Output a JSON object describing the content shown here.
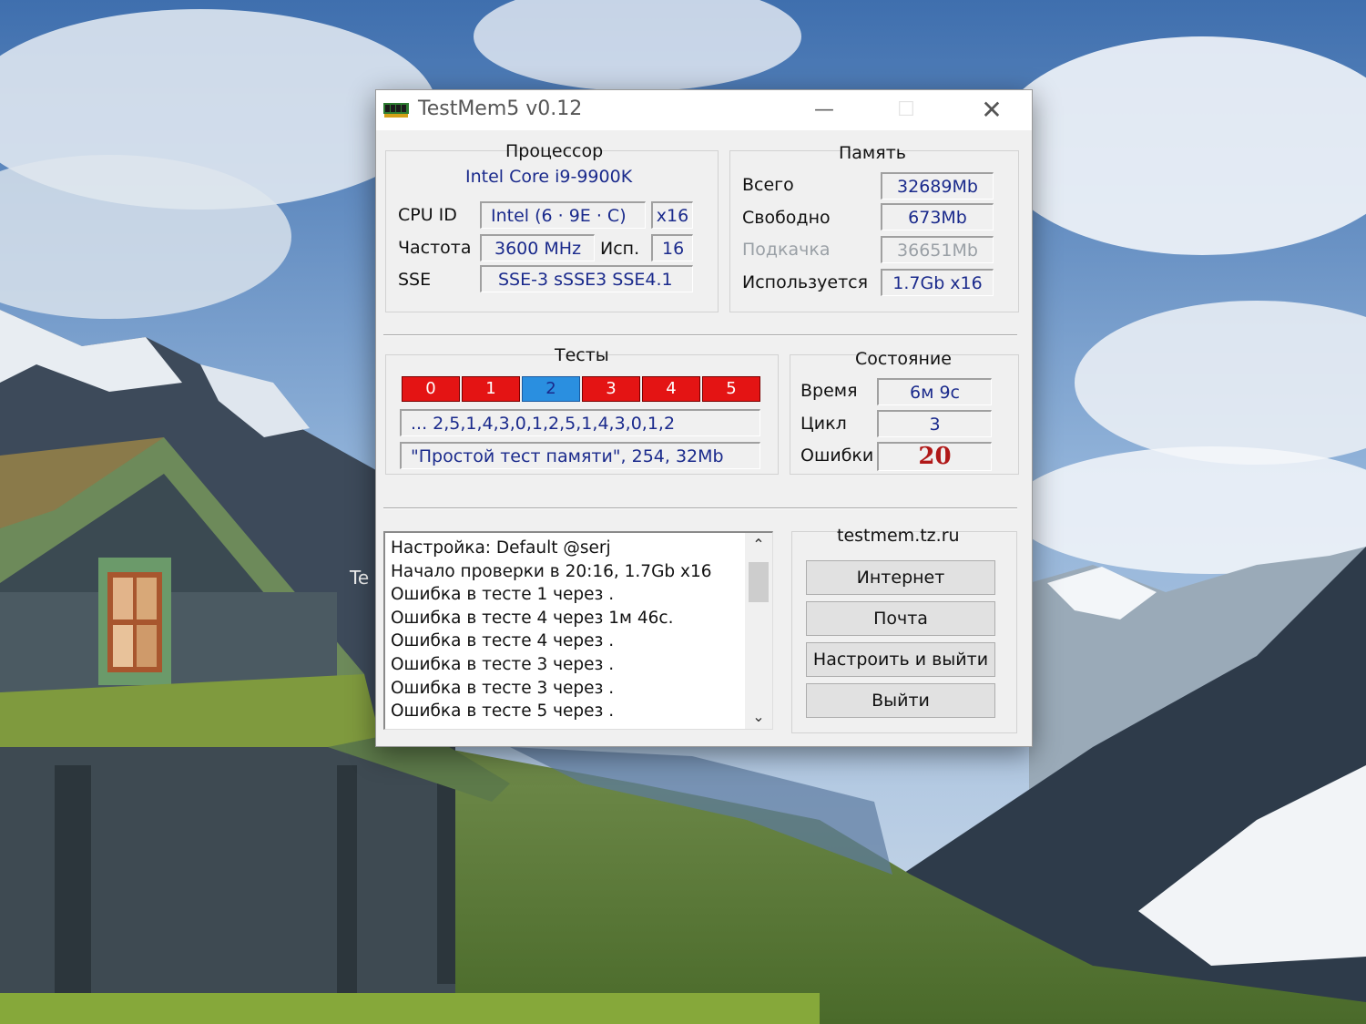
{
  "window": {
    "title": "TestMem5 v0.12",
    "minimize_glyph": "—",
    "maximize_glyph": "☐",
    "close_glyph": "✕"
  },
  "processor": {
    "header": "Процессор",
    "model": "Intel Core i9-9900K",
    "cpu_id_label": "CPU ID",
    "cpu_id_value": "Intel (6 · 9E · C)",
    "threads_value": "x16",
    "freq_label": "Частота",
    "freq_value": "3600 MHz",
    "used_label": "Исп.",
    "used_value": "16",
    "sse_label": "SSE",
    "sse_value": "SSE-3 sSSE3 SSE4.1"
  },
  "memory": {
    "header": "Память",
    "total_label": "Всего",
    "total_value": "32689Mb",
    "free_label": "Свободно",
    "free_value": "673Mb",
    "swap_label": "Подкачка",
    "swap_value": "36651Mb",
    "in_use_label": "Используется",
    "in_use_value": "1.7Gb x16"
  },
  "tests": {
    "header": "Тесты",
    "cells": [
      {
        "label": "0",
        "state": "error",
        "color": "#e41414"
      },
      {
        "label": "1",
        "state": "error",
        "color": "#e41414"
      },
      {
        "label": "2",
        "state": "current",
        "color": "#2a8fe0"
      },
      {
        "label": "3",
        "state": "error",
        "color": "#e41414"
      },
      {
        "label": "4",
        "state": "error",
        "color": "#e41414"
      },
      {
        "label": "5",
        "state": "error",
        "color": "#e41414"
      }
    ],
    "sequence": "... 2,5,1,4,3,0,1,2,5,1,4,3,0,1,2",
    "current_test": "\"Простой тест памяти\", 254, 32Mb"
  },
  "status": {
    "header": "Состояние",
    "time_label": "Время",
    "time_value": "6м 9с",
    "cycle_label": "Цикл",
    "cycle_value": "3",
    "errors_label": "Ошибки",
    "errors_value": "20"
  },
  "log": {
    "lines": [
      "Настройка: Default @serj",
      "Начало проверки в 20:16, 1.7Gb x16",
      "Ошибка в тесте 1 через .",
      "Ошибка в тесте 4 через 1м 46с.",
      "Ошибка в тесте 4 через .",
      "Ошибка в тесте 3 через .",
      "Ошибка в тесте 3 через .",
      "Ошибка в тесте 5 через ."
    ]
  },
  "links": {
    "site": "testmem.tz.ru",
    "internet_button": "Интернет",
    "mail_button": "Почта",
    "configure_exit_button": "Настроить и выйти",
    "exit_button": "Выйти"
  },
  "desktop": {
    "partial_icon_label": "Te"
  },
  "colors": {
    "error_cell": "#e41414",
    "current_cell": "#2a8fe0",
    "value_text": "#1a2a8c",
    "errors_count": "#b01818"
  },
  "icons": {
    "app": "memory-chip-icon",
    "scroll_up": "chevron-up-icon",
    "scroll_down": "chevron-down-icon"
  }
}
